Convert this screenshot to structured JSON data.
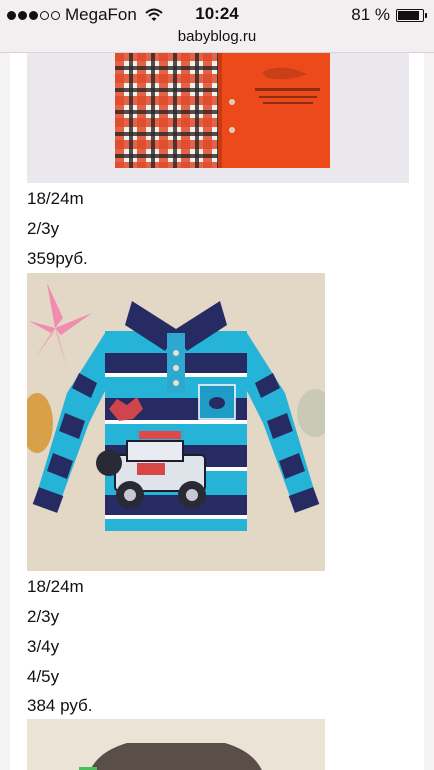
{
  "status_bar": {
    "carrier": "MegaFon",
    "time": "10:24",
    "battery": "81 %",
    "battery_level": 0.81,
    "signal_bars": 3,
    "signal_total": 5
  },
  "address_bar": {
    "url": "babyblog.ru"
  },
  "products": [
    {
      "sizes": [
        "18/24m",
        "2/3y"
      ],
      "price": "359руб."
    },
    {
      "sizes": [
        "18/24m",
        "2/3y",
        "3/4y",
        "4/5y"
      ],
      "price": "384 руб."
    }
  ],
  "colors": {
    "accent_red": "#e8461a",
    "navy": "#2b2f66",
    "turquoise": "#25b4d8"
  }
}
